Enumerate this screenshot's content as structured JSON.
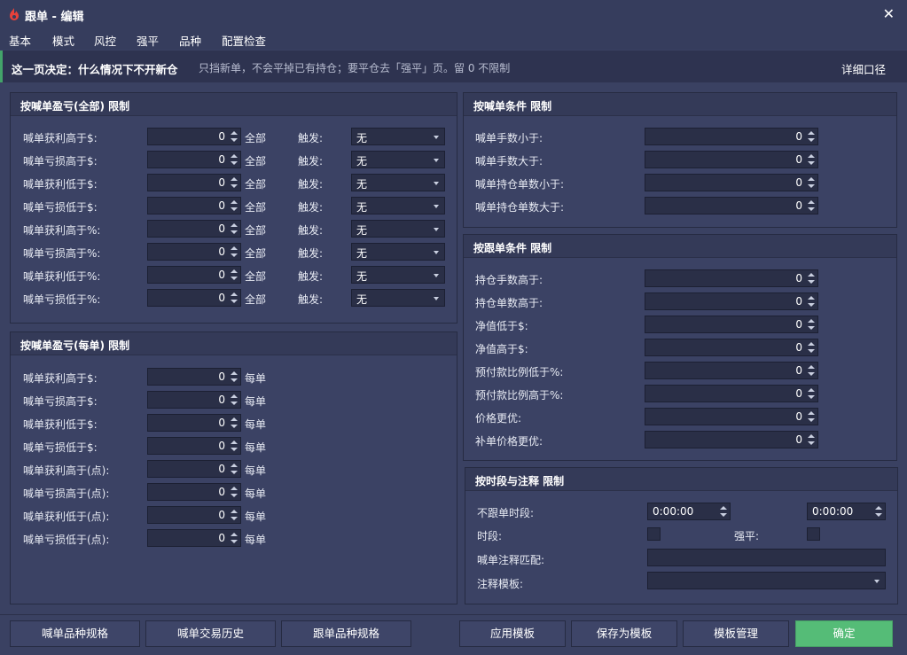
{
  "window": {
    "title": "跟单 - 编辑",
    "close": "✕"
  },
  "tabs": [
    "基本",
    "模式",
    "风控",
    "强平",
    "品种",
    "配置检查"
  ],
  "notice": {
    "title": "这一页决定：什么情况下不开新仓",
    "desc": "只挡新单，不会平掉已有持仓；要平仓去「强平」页。留 0 不限制",
    "link": "详细口径"
  },
  "panel_all": {
    "title": "按喊单盈亏(全部) 限制",
    "scope": "全部",
    "trigger_label": "触发:",
    "trigger_value": "无",
    "rows": [
      {
        "label": "喊单获利高于$:",
        "value": "0"
      },
      {
        "label": "喊单亏损高于$:",
        "value": "0"
      },
      {
        "label": "喊单获利低于$:",
        "value": "0"
      },
      {
        "label": "喊单亏损低于$:",
        "value": "0"
      },
      {
        "label": "喊单获利高于%:",
        "value": "0"
      },
      {
        "label": "喊单亏损高于%:",
        "value": "0"
      },
      {
        "label": "喊单获利低于%:",
        "value": "0"
      },
      {
        "label": "喊单亏损低于%:",
        "value": "0"
      }
    ]
  },
  "panel_each": {
    "title": "按喊单盈亏(每单) 限制",
    "scope": "每单",
    "rows": [
      {
        "label": "喊单获利高于$:",
        "value": "0"
      },
      {
        "label": "喊单亏损高于$:",
        "value": "0"
      },
      {
        "label": "喊单获利低于$:",
        "value": "0"
      },
      {
        "label": "喊单亏损低于$:",
        "value": "0"
      },
      {
        "label": "喊单获利高于(点):",
        "value": "0"
      },
      {
        "label": "喊单亏损高于(点):",
        "value": "0"
      },
      {
        "label": "喊单获利低于(点):",
        "value": "0"
      },
      {
        "label": "喊单亏损低于(点):",
        "value": "0"
      }
    ]
  },
  "panel_signal_cond": {
    "title": "按喊单条件 限制",
    "rows": [
      {
        "label": "喊单手数小于:",
        "value": "0"
      },
      {
        "label": "喊单手数大于:",
        "value": "0"
      },
      {
        "label": "喊单持仓单数小于:",
        "value": "0"
      },
      {
        "label": "喊单持仓单数大于:",
        "value": "0"
      }
    ]
  },
  "panel_follow_cond": {
    "title": "按跟单条件 限制",
    "rows": [
      {
        "label": "持仓手数高于:",
        "value": "0"
      },
      {
        "label": "持仓单数高于:",
        "value": "0"
      },
      {
        "label": "净值低于$:",
        "value": "0"
      },
      {
        "label": "净值高于$:",
        "value": "0"
      },
      {
        "label": "预付款比例低于%:",
        "value": "0"
      },
      {
        "label": "预付款比例高于%:",
        "value": "0"
      },
      {
        "label": "价格更优:",
        "value": "0"
      },
      {
        "label": "补单价格更优:",
        "value": "0"
      }
    ]
  },
  "panel_time": {
    "title": "按时段与注释 限制",
    "no_follow_label": "不跟单时段:",
    "time_start": "0:00:00",
    "time_end": "0:00:00",
    "period_label": "时段:",
    "force_close_label": "强平:",
    "comment_match_label": "喊单注释匹配:",
    "comment_template_label": "注释模板:"
  },
  "buttons": {
    "signal_spec": "喊单品种规格",
    "signal_history": "喊单交易历史",
    "follow_spec": "跟单品种规格",
    "apply_template": "应用模板",
    "save_template": "保存为模板",
    "manage_template": "模板管理",
    "ok": "确定"
  }
}
